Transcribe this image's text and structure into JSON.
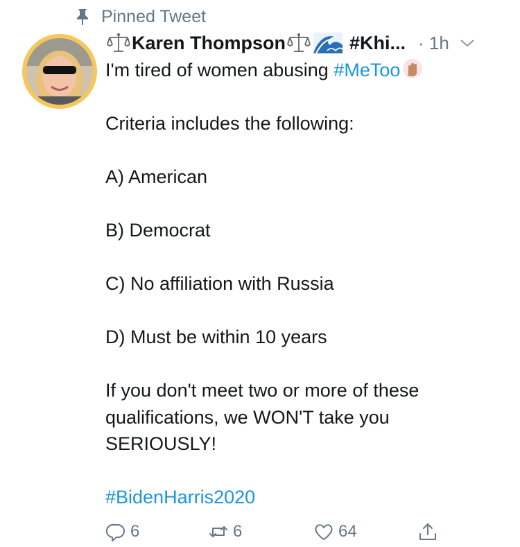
{
  "pinned": {
    "label": "Pinned Tweet",
    "icon": "pin-icon"
  },
  "author": {
    "name": "Karen Thompson",
    "name_tail": "#Khi...",
    "time": "· 1h",
    "avatar": "profile-photo",
    "emoji": [
      "balance-scale-icon",
      "balance-scale-icon",
      "water-wave-icon"
    ]
  },
  "tweet": {
    "line1_text": "I'm tired of women abusing ",
    "line1_hashtag": "#MeToo",
    "line2": "Criteria includes the following:",
    "item_a": "A) American",
    "item_b": "B) Democrat",
    "item_c": "C) No affiliation with Russia",
    "item_d": "D) Must be within 10 years",
    "closing": "If you don't meet two or more of these qualifications, we WON'T take you SERIOUSLY!",
    "hashtag_bottom": "#BidenHarris2020"
  },
  "actions": {
    "reply_count": "6",
    "retweet_count": "6",
    "like_count": "64"
  },
  "colors": {
    "link": "#1b95e0",
    "muted": "#657786",
    "avatar_ring": "#f6c75b"
  }
}
